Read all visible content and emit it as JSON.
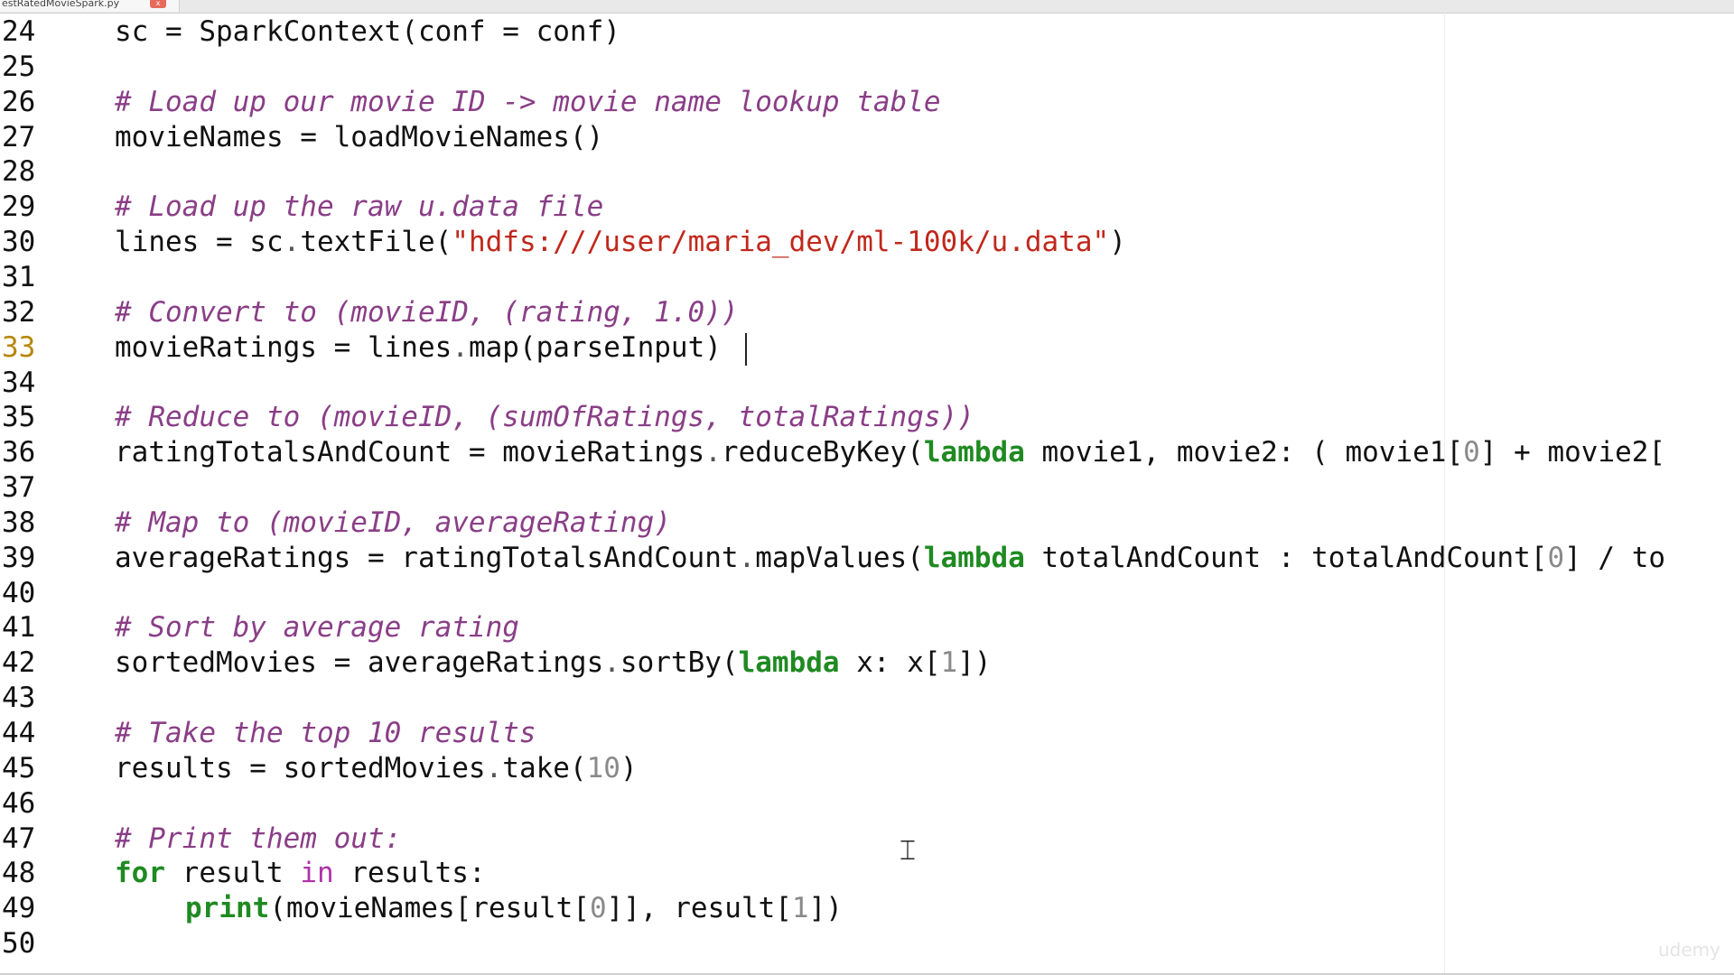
{
  "tab": {
    "title": "estRatedMovieSpark.py",
    "close_glyph": "x"
  },
  "editor": {
    "current_line": "33",
    "lines": [
      {
        "n": "24",
        "segs": [
          {
            "t": "sc = SparkContext(conf = conf)",
            "c": "plain"
          }
        ]
      },
      {
        "n": "25",
        "segs": []
      },
      {
        "n": "26",
        "segs": [
          {
            "t": "# Load up our movie ID -> movie name lookup table",
            "c": "cm"
          }
        ]
      },
      {
        "n": "27",
        "segs": [
          {
            "t": "movieNames = loadMovieNames()",
            "c": "plain"
          }
        ]
      },
      {
        "n": "28",
        "segs": []
      },
      {
        "n": "29",
        "segs": [
          {
            "t": "# Load up the raw u.data file",
            "c": "cm"
          }
        ]
      },
      {
        "n": "30",
        "segs": [
          {
            "t": "lines = sc",
            "c": "plain"
          },
          {
            "t": ".",
            "c": "dot"
          },
          {
            "t": "textFile(",
            "c": "plain"
          },
          {
            "t": "\"hdfs:///user/maria_dev/ml-100k/u.data\"",
            "c": "str"
          },
          {
            "t": ")",
            "c": "plain"
          }
        ]
      },
      {
        "n": "31",
        "segs": []
      },
      {
        "n": "32",
        "segs": [
          {
            "t": "# Convert to (movieID, (rating, 1.0))",
            "c": "cm"
          }
        ]
      },
      {
        "n": "33",
        "segs": [
          {
            "t": "movieRatings = lines",
            "c": "plain"
          },
          {
            "t": ".",
            "c": "dot"
          },
          {
            "t": "map(parseInput)",
            "c": "plain"
          }
        ]
      },
      {
        "n": "34",
        "segs": []
      },
      {
        "n": "35",
        "segs": [
          {
            "t": "# Reduce to (movieID, (sumOfRatings, totalRatings))",
            "c": "cm"
          }
        ]
      },
      {
        "n": "36",
        "segs": [
          {
            "t": "ratingTotalsAndCount = movieRatings",
            "c": "plain"
          },
          {
            "t": ".",
            "c": "dot"
          },
          {
            "t": "reduceByKey(",
            "c": "plain"
          },
          {
            "t": "lambda",
            "c": "kw"
          },
          {
            "t": " movie1, movie2: ( movie1[",
            "c": "plain"
          },
          {
            "t": "0",
            "c": "num"
          },
          {
            "t": "] + movie2[",
            "c": "plain"
          }
        ]
      },
      {
        "n": "37",
        "segs": []
      },
      {
        "n": "38",
        "segs": [
          {
            "t": "# Map to (movieID, averageRating)",
            "c": "cm"
          }
        ]
      },
      {
        "n": "39",
        "segs": [
          {
            "t": "averageRatings = ratingTotalsAndCount",
            "c": "plain"
          },
          {
            "t": ".",
            "c": "dot"
          },
          {
            "t": "mapValues(",
            "c": "plain"
          },
          {
            "t": "lambda",
            "c": "kw"
          },
          {
            "t": " totalAndCount : totalAndCount[",
            "c": "plain"
          },
          {
            "t": "0",
            "c": "num"
          },
          {
            "t": "] / to",
            "c": "plain"
          }
        ]
      },
      {
        "n": "40",
        "segs": []
      },
      {
        "n": "41",
        "segs": [
          {
            "t": "# Sort by average rating",
            "c": "cm"
          }
        ]
      },
      {
        "n": "42",
        "segs": [
          {
            "t": "sortedMovies = averageRatings",
            "c": "plain"
          },
          {
            "t": ".",
            "c": "dot"
          },
          {
            "t": "sortBy(",
            "c": "plain"
          },
          {
            "t": "lambda",
            "c": "kw"
          },
          {
            "t": " x: x[",
            "c": "plain"
          },
          {
            "t": "1",
            "c": "num"
          },
          {
            "t": "])",
            "c": "plain"
          }
        ]
      },
      {
        "n": "43",
        "segs": []
      },
      {
        "n": "44",
        "segs": [
          {
            "t": "# Take the top 10 results",
            "c": "cm"
          }
        ]
      },
      {
        "n": "45",
        "segs": [
          {
            "t": "results = sortedMovies",
            "c": "plain"
          },
          {
            "t": ".",
            "c": "dot"
          },
          {
            "t": "take(",
            "c": "plain"
          },
          {
            "t": "10",
            "c": "num"
          },
          {
            "t": ")",
            "c": "plain"
          }
        ]
      },
      {
        "n": "46",
        "segs": []
      },
      {
        "n": "47",
        "segs": [
          {
            "t": "# Print them out:",
            "c": "cm"
          }
        ]
      },
      {
        "n": "48",
        "segs": [
          {
            "t": "for",
            "c": "kw"
          },
          {
            "t": " result ",
            "c": "plain"
          },
          {
            "t": "in",
            "c": "kw2"
          },
          {
            "t": " results:",
            "c": "plain"
          }
        ]
      },
      {
        "n": "49",
        "indent": 2,
        "segs": [
          {
            "t": "print",
            "c": "kw"
          },
          {
            "t": "(movieNames[result[",
            "c": "plain"
          },
          {
            "t": "0",
            "c": "num"
          },
          {
            "t": "]], result[",
            "c": "plain"
          },
          {
            "t": "1",
            "c": "num"
          },
          {
            "t": "])",
            "c": "plain"
          }
        ]
      },
      {
        "n": "50",
        "segs": []
      }
    ]
  },
  "watermark": "udemy",
  "colors": {
    "comment": "#8a3e87",
    "string": "#c0281c",
    "keyword": "#1f8a22",
    "keyword_in": "#b033a8",
    "number": "#8a8a8a",
    "current_line_number": "#b8860b"
  }
}
